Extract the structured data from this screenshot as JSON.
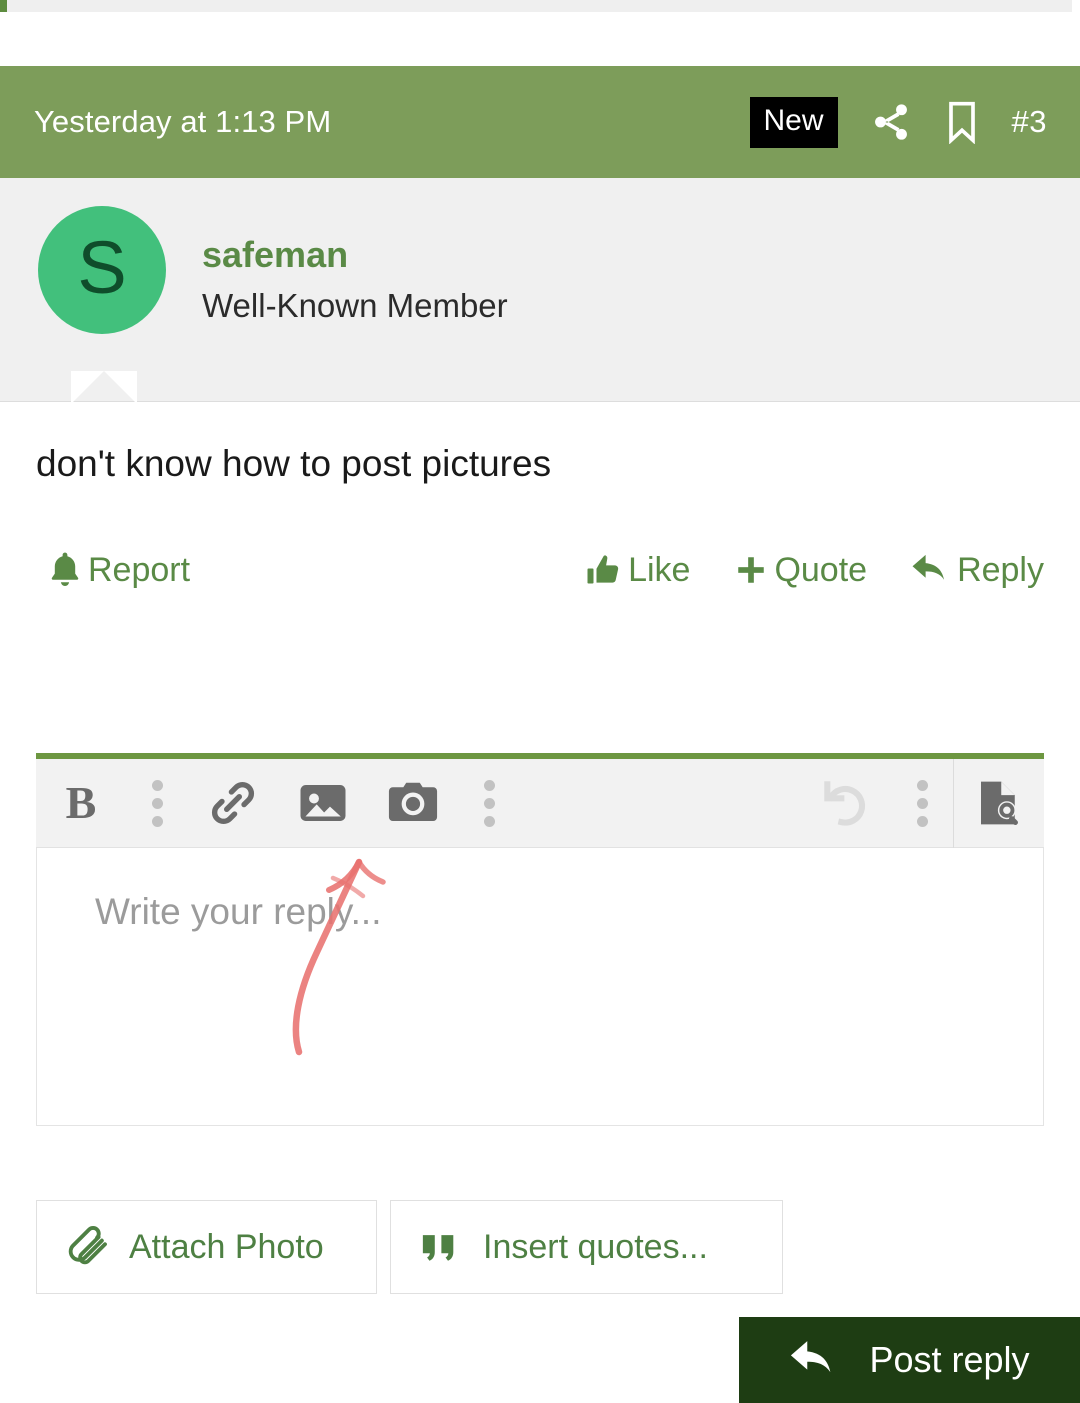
{
  "post": {
    "timestamp": "Yesterday at 1:13 PM",
    "new_badge": "New",
    "share_icon": "share-icon",
    "bookmark_icon": "bookmark-icon",
    "post_number": "#3",
    "author": {
      "avatar_letter": "S",
      "username": "safeman",
      "title": "Well-Known Member"
    },
    "content": "don't know how to post pictures",
    "actions": {
      "report": "Report",
      "like": "Like",
      "quote": "Quote",
      "reply": "Reply"
    }
  },
  "editor": {
    "toolbar": [
      {
        "name": "bold-button",
        "label": "B",
        "icon": "bold-icon",
        "state": "enabled"
      },
      {
        "name": "more-text-options",
        "label": "",
        "icon": "vertical-dots-icon",
        "state": "enabled"
      },
      {
        "name": "insert-link-button",
        "label": "",
        "icon": "link-icon",
        "state": "enabled"
      },
      {
        "name": "insert-image-button",
        "label": "",
        "icon": "image-icon",
        "state": "enabled"
      },
      {
        "name": "camera-button",
        "label": "",
        "icon": "camera-icon",
        "state": "enabled"
      },
      {
        "name": "more-insert-options",
        "label": "",
        "icon": "vertical-dots-icon",
        "state": "enabled"
      },
      {
        "name": "undo-button",
        "label": "",
        "icon": "undo-icon",
        "state": "disabled"
      },
      {
        "name": "more-history-options",
        "label": "",
        "icon": "vertical-dots-icon",
        "state": "enabled"
      },
      {
        "name": "preview-button",
        "label": "",
        "icon": "document-search-icon",
        "state": "enabled"
      }
    ],
    "placeholder": "Write your reply...",
    "value": "",
    "attach_photo": "Attach Photo",
    "insert_quotes": "Insert quotes...",
    "post_reply": "Post reply"
  },
  "annotation": {
    "type": "hand-drawn-arrow",
    "color": "#e86a6a",
    "points_to": "insert-image-button"
  },
  "colors": {
    "header_green": "#7d9d5a",
    "link_green": "#5a8a46",
    "avatar_green": "#42c07c",
    "button_dark_green": "#1e3d13",
    "editor_accent": "#6d9741",
    "badge_black": "#000000",
    "annotation_red": "#e86a6a"
  }
}
